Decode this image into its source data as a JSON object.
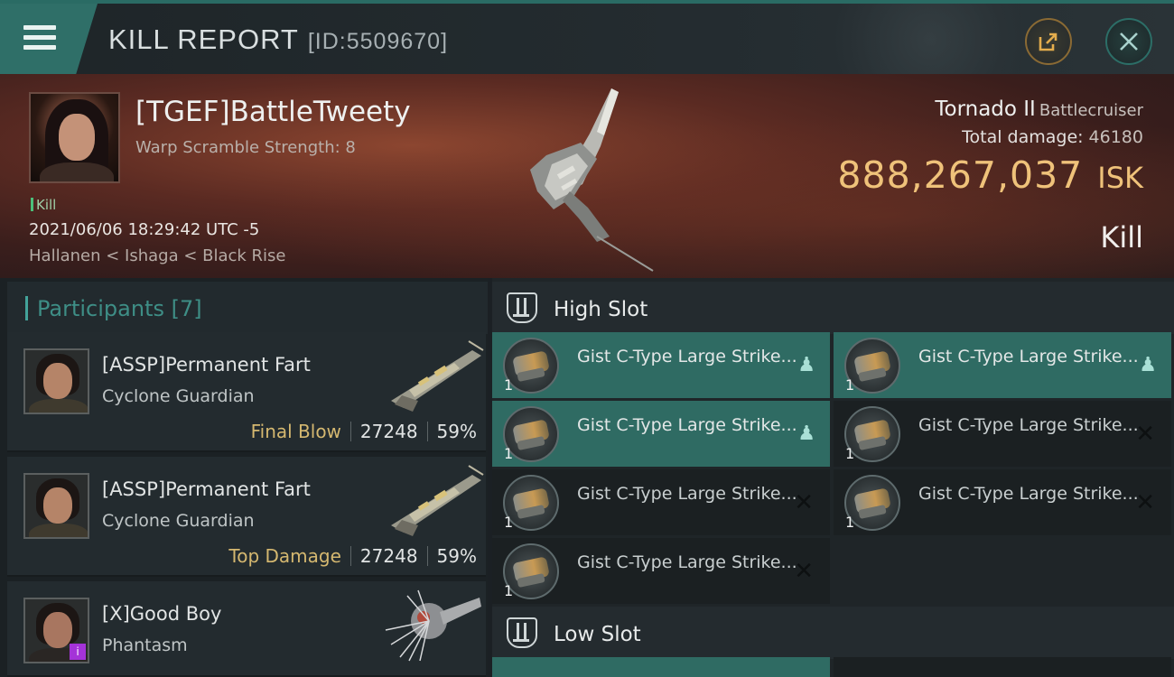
{
  "header": {
    "title": "KILL REPORT",
    "report_id": "[ID:5509670]"
  },
  "victim": {
    "name": "[TGEF]BattleTweety",
    "warp_scramble": "Warp Scramble Strength: 8",
    "kill_tag": "Kill",
    "timestamp": "2021/06/06 18:29:42 UTC -5",
    "location": "Hallanen < Ishaga < Black Rise",
    "ship_name": "Tornado II",
    "ship_class": "Battlecruiser",
    "total_damage_label": "Total damage:",
    "total_damage_value": "46180",
    "isk_value": "888,267,037",
    "isk_unit": "ISK",
    "result": "Kill"
  },
  "participants": {
    "title": "Participants [7]",
    "rows": [
      {
        "name": "[ASSP]Permanent Fart",
        "ship": "Cyclone Guardian",
        "role": "Final Blow",
        "damage": "27248",
        "percent": "59%"
      },
      {
        "name": "[ASSP]Permanent Fart",
        "ship": "Cyclone Guardian",
        "role": "Top Damage",
        "damage": "27248",
        "percent": "59%"
      },
      {
        "name": "[X]Good Boy",
        "ship": "Phantasm",
        "badge": "i"
      }
    ]
  },
  "fitting": {
    "high_slot_label": "High Slot",
    "low_slot_label": "Low Slot",
    "high_items": [
      {
        "name": "Gist C-Type Large Strike...",
        "qty": "1"
      },
      {
        "name": "Gist C-Type Large Strike...",
        "qty": "1"
      },
      {
        "name": "Gist C-Type Large Strike...",
        "qty": "1"
      },
      {
        "name": "Gist C-Type Large Strike...",
        "qty": "1"
      },
      {
        "name": "Gist C-Type Large Strike...",
        "qty": "1"
      },
      {
        "name": "Gist C-Type Large Strike...",
        "qty": "1"
      },
      {
        "name": "Gist C-Type Large Strike...",
        "qty": "1"
      }
    ]
  },
  "colors": {
    "accent": "#2f6b63",
    "isk": "#efc27a",
    "role": "#d5b870"
  }
}
